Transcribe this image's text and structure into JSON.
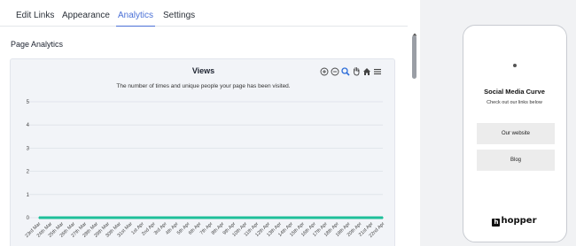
{
  "tabs": [
    {
      "label": "Edit Links",
      "active": false
    },
    {
      "label": "Appearance",
      "active": false
    },
    {
      "label": "Analytics",
      "active": true
    },
    {
      "label": "Settings",
      "active": false
    }
  ],
  "section_title": "Page Analytics",
  "chart_toolbar_icons": [
    "zoom-in-icon",
    "zoom-out-icon",
    "magnify-icon",
    "pan-hand-icon",
    "home-icon",
    "menu-icon"
  ],
  "chart_data": {
    "type": "line",
    "title": "Views",
    "subtitle": "The number of times and unique people your page has been visited.",
    "xlabel": "",
    "ylabel": "",
    "ylim": [
      0,
      5
    ],
    "yticks": [
      0,
      1,
      2,
      3,
      4,
      5
    ],
    "grid": true,
    "categories": [
      "23rd Mar",
      "24th Mar",
      "25th Mar",
      "26th Mar",
      "27th Mar",
      "28th Mar",
      "29th Mar",
      "30th Mar",
      "31st Mar",
      "1st Apr",
      "2nd Apr",
      "3rd Apr",
      "4th Apr",
      "5th Apr",
      "6th Apr",
      "7th Apr",
      "8th Apr",
      "9th Apr",
      "10th Apr",
      "11th Apr",
      "12th Apr",
      "13th Apr",
      "14th Apr",
      "15th Apr",
      "16th Apr",
      "17th Apr",
      "18th Apr",
      "19th Apr",
      "20th Apr",
      "21st Apr",
      "22nd Apr"
    ],
    "series": [
      {
        "values": [
          0,
          0,
          0,
          0,
          0,
          0,
          0,
          0,
          0,
          0,
          0,
          0,
          0,
          0,
          0,
          0,
          0,
          0,
          0,
          0,
          0,
          0,
          0,
          0,
          0,
          0,
          0,
          0,
          0,
          0,
          0
        ],
        "color": "#1fbf9a"
      }
    ]
  },
  "preview": {
    "name": "Social Media Curve",
    "bio": "Check out our links below",
    "links": [
      "Our website",
      "Blog"
    ],
    "brand_mark": "h",
    "brand": "hopper"
  },
  "colors": {
    "accent": "#4a70d6",
    "series": "#1fbf9a"
  }
}
